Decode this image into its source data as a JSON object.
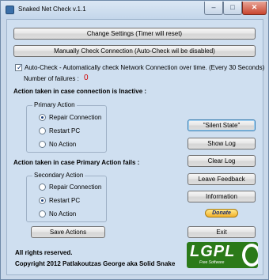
{
  "window": {
    "title": "Snaked Net Check v.1.1"
  },
  "titlebar": {
    "minimize": "–",
    "maximize": "□",
    "close": "✕"
  },
  "buttons": {
    "change_settings": "Change Settings (Timer will reset)",
    "manual_check": "Manually Check Connection (Auto-Check wil be disabled)",
    "silent_state": "\"Silent State\"",
    "show_log": "Show Log",
    "clear_log": "Clear Log",
    "leave_feedback": "Leave Feedback",
    "information": "Information",
    "donate": "Donate",
    "exit": "Exit",
    "save_actions": "Save Actions"
  },
  "autocheck": {
    "checked": true,
    "label": "Auto-Check - Automatically check Network Connection over time. (Every 30 Seconds)"
  },
  "failures": {
    "label": "Number of failures :",
    "count": "0"
  },
  "primary": {
    "heading": "Action taken in case connection is Inactive :",
    "group_label": "Primary Action",
    "options": [
      "Repair Connection",
      "Restart PC",
      "No Action"
    ],
    "selected": "Repair Connection"
  },
  "secondary": {
    "heading": "Action taken in case Primary Action fails :",
    "group_label": "Secondary Action",
    "options": [
      "Repair Connection",
      "Restart PC",
      "No Action"
    ],
    "selected": "Restart PC"
  },
  "footer": {
    "rights": "All rights reserved.",
    "copyright": "Copyright 2012 Patlakoutzas George aka Solid Snake"
  },
  "logo": {
    "text": "LGPL",
    "subtext": "Free Software",
    "version": "v3"
  },
  "colors": {
    "failures_count": "#d00000",
    "logo_green": "#2b7a19",
    "close_red": "#c9452f"
  }
}
